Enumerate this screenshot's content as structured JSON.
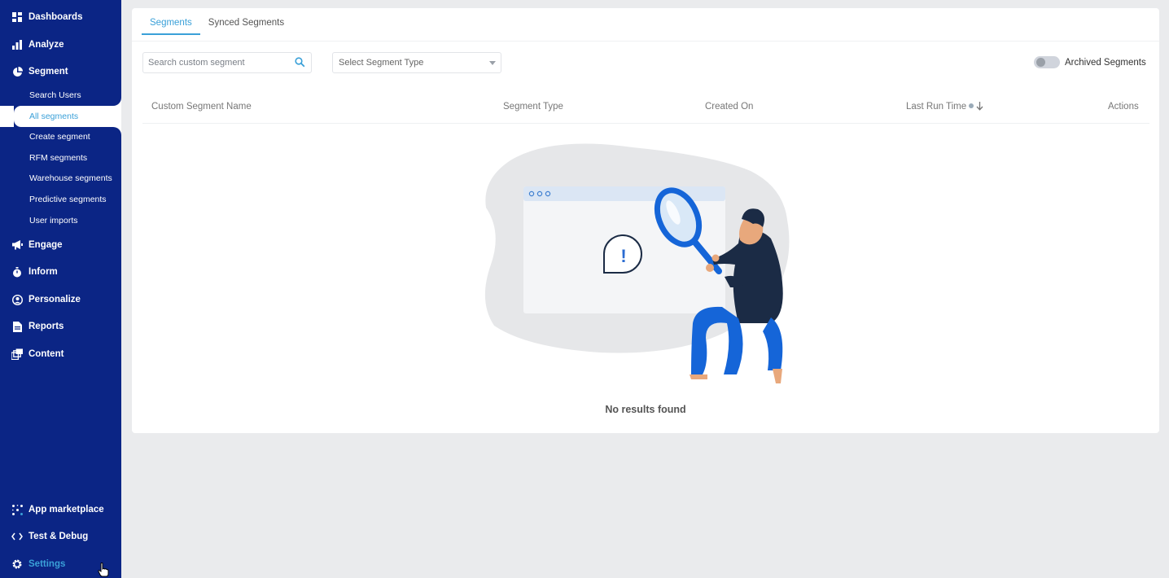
{
  "sidebar": {
    "items": [
      {
        "label": "Dashboards",
        "icon": "dashboard-icon"
      },
      {
        "label": "Analyze",
        "icon": "bar-chart-icon"
      },
      {
        "label": "Segment",
        "icon": "pie-chart-icon"
      },
      {
        "label": "Engage",
        "icon": "megaphone-icon"
      },
      {
        "label": "Inform",
        "icon": "stopwatch-icon"
      },
      {
        "label": "Personalize",
        "icon": "user-circle-icon"
      },
      {
        "label": "Reports",
        "icon": "document-icon"
      },
      {
        "label": "Content",
        "icon": "layers-icon"
      }
    ],
    "segment_subitems": [
      {
        "label": "Search Users"
      },
      {
        "label": "All segments",
        "active": true
      },
      {
        "label": "Create segment"
      },
      {
        "label": "RFM segments"
      },
      {
        "label": "Warehouse segments"
      },
      {
        "label": "Predictive segments"
      },
      {
        "label": "User imports"
      }
    ],
    "bottom_items": [
      {
        "label": "App marketplace",
        "icon": "marketplace-icon"
      },
      {
        "label": "Test & Debug",
        "icon": "code-icon"
      },
      {
        "label": "Settings",
        "icon": "gear-icon"
      }
    ]
  },
  "tabs": [
    {
      "label": "Segments",
      "active": true
    },
    {
      "label": "Synced Segments",
      "active": false
    }
  ],
  "filters": {
    "search_placeholder": "Search custom segment",
    "segment_type_value": "Select Segment Type",
    "archived_label": "Archived Segments",
    "archived_on": false
  },
  "table": {
    "columns": [
      "Custom Segment Name",
      "Segment Type",
      "Created On",
      "Last Run Time",
      "Actions"
    ]
  },
  "empty_state": {
    "message": "No results found",
    "dialog_symbol": "!"
  },
  "colors": {
    "sidebar_bg": "#0b2585",
    "accent": "#3aa0d8",
    "page_bg": "#eaebed"
  }
}
